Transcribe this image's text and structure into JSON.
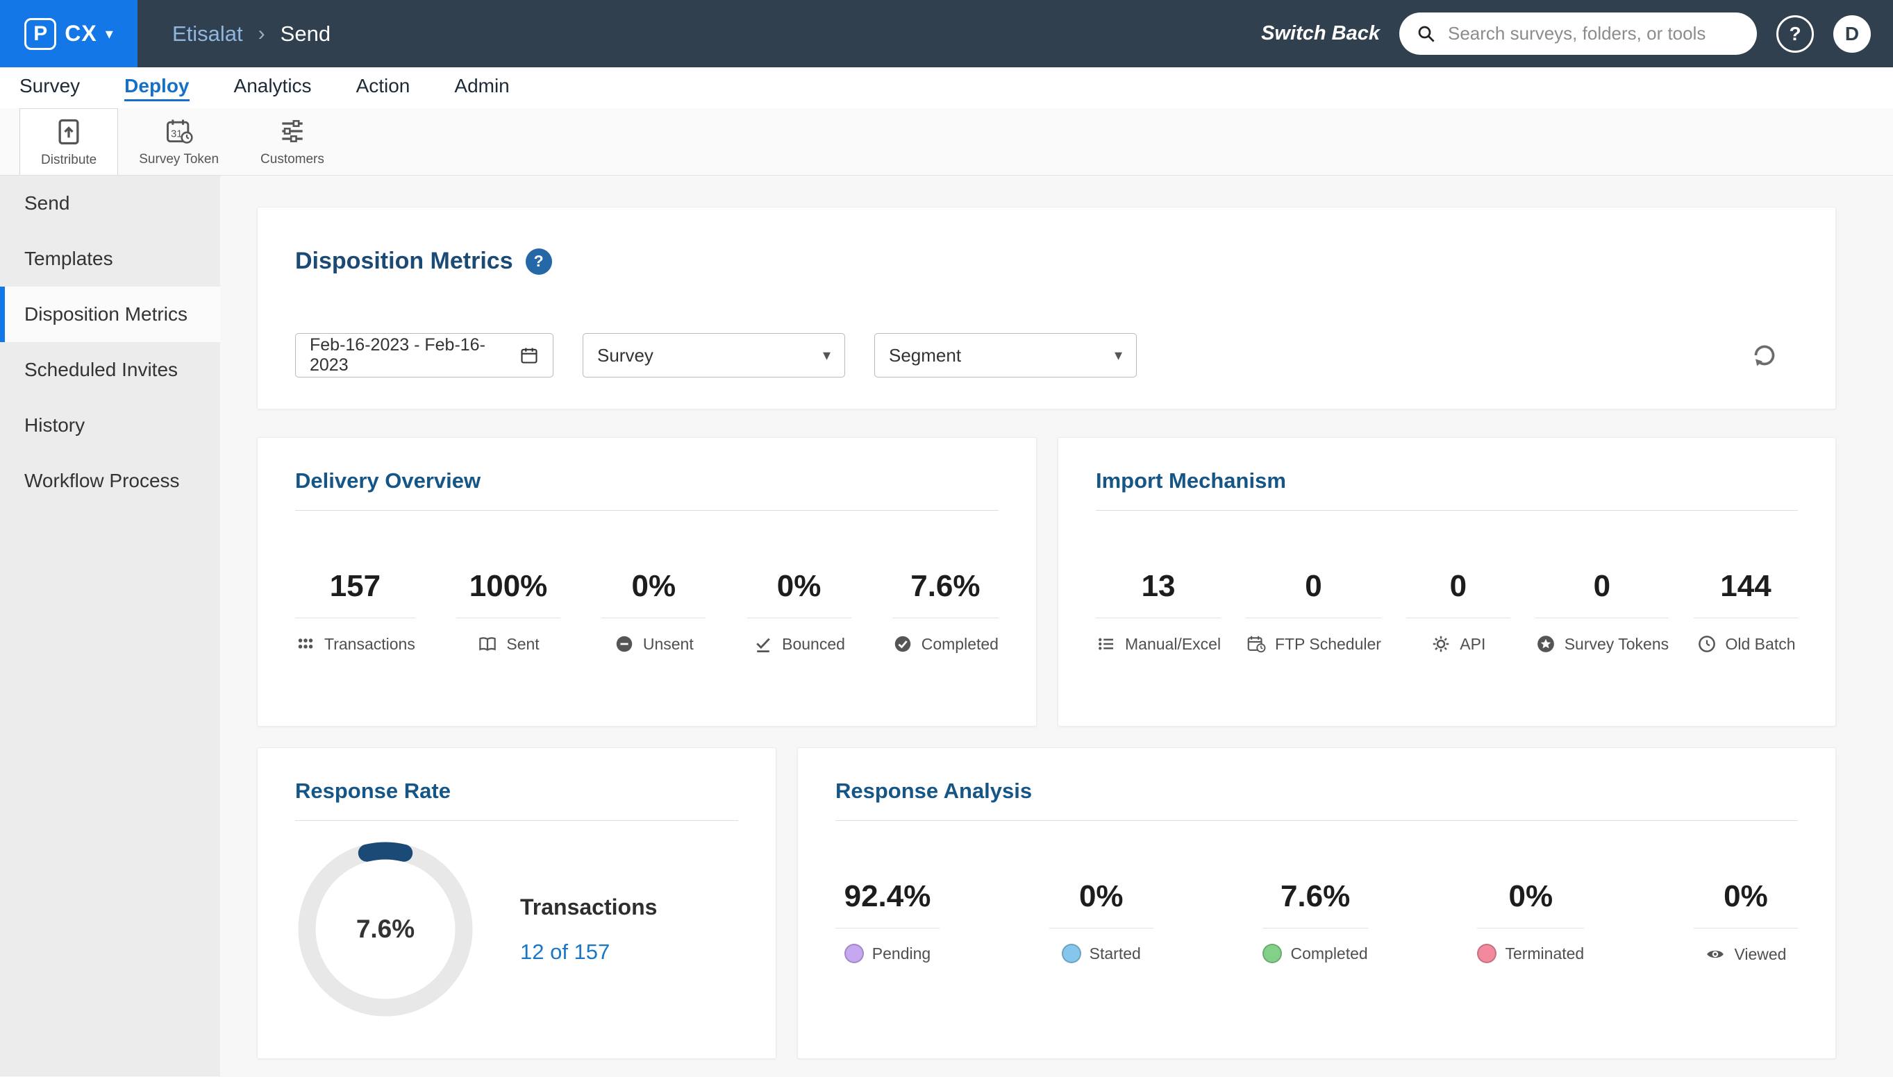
{
  "colors": {
    "accent": "#1377e8",
    "nav_active": "#1670c8",
    "link": "#1877c9",
    "donut_arc": "#1c4a77",
    "topbar": "#31404e"
  },
  "topbar": {
    "logo_text": "CX",
    "logo_badge": "P",
    "breadcrumb": {
      "app": "Etisalat",
      "separator": "›",
      "page": "Send"
    },
    "switch_back": "Switch Back",
    "search_placeholder": "Search surveys, folders, or tools",
    "help_label": "?",
    "avatar_label": "D"
  },
  "nav": {
    "items": [
      {
        "label": "Survey",
        "active": false
      },
      {
        "label": "Deploy",
        "active": true
      },
      {
        "label": "Analytics",
        "active": false
      },
      {
        "label": "Action",
        "active": false
      },
      {
        "label": "Admin",
        "active": false
      }
    ]
  },
  "toolbar": {
    "items": [
      {
        "label": "Distribute",
        "icon": "distribute-icon",
        "active": true
      },
      {
        "label": "Survey Token",
        "icon": "survey-token-icon",
        "active": false
      },
      {
        "label": "Customers",
        "icon": "customers-icon",
        "active": false
      }
    ]
  },
  "sidebar": {
    "items": [
      {
        "label": "Send",
        "active": false
      },
      {
        "label": "Templates",
        "active": false
      },
      {
        "label": "Disposition Metrics",
        "active": true
      },
      {
        "label": "Scheduled Invites",
        "active": false
      },
      {
        "label": "History",
        "active": false
      },
      {
        "label": "Workflow Process",
        "active": false
      }
    ]
  },
  "filters": {
    "title": "Disposition Metrics",
    "help_label": "?",
    "date_range": "Feb-16-2023 - Feb-16-2023",
    "survey_label": "Survey",
    "segment_label": "Segment"
  },
  "delivery_overview": {
    "title": "Delivery Overview",
    "stats": [
      {
        "value": "157",
        "label": "Transactions",
        "icon": "grid-icon"
      },
      {
        "value": "100%",
        "label": "Sent",
        "icon": "book-icon"
      },
      {
        "value": "0%",
        "label": "Unsent",
        "icon": "minus-circle-icon"
      },
      {
        "value": "0%",
        "label": "Bounced",
        "icon": "check-underline-icon"
      },
      {
        "value": "7.6%",
        "label": "Completed",
        "icon": "check-circle-icon"
      }
    ]
  },
  "import_mechanism": {
    "title": "Import Mechanism",
    "stats": [
      {
        "value": "13",
        "label": "Manual/Excel",
        "icon": "list-icon"
      },
      {
        "value": "0",
        "label": "FTP Scheduler",
        "icon": "calendar-clock-icon"
      },
      {
        "value": "0",
        "label": "API",
        "icon": "gear-icon"
      },
      {
        "value": "0",
        "label": "Survey Tokens",
        "icon": "star-circle-icon"
      },
      {
        "value": "144",
        "label": "Old Batch",
        "icon": "history-icon"
      }
    ]
  },
  "response_rate": {
    "title": "Response Rate",
    "percent_label": "7.6%",
    "percent_value": 7.6,
    "transactions_label": "Transactions",
    "transactions_value": "12 of 157"
  },
  "response_analysis": {
    "title": "Response Analysis",
    "stats": [
      {
        "value": "92.4%",
        "label": "Pending",
        "color": "#c5a8f0"
      },
      {
        "value": "0%",
        "label": "Started",
        "color": "#85c6ec"
      },
      {
        "value": "7.6%",
        "label": "Completed",
        "color": "#83d189"
      },
      {
        "value": "0%",
        "label": "Terminated",
        "color": "#f2899d"
      },
      {
        "value": "0%",
        "label": "Viewed",
        "icon": "eye-icon"
      }
    ]
  }
}
